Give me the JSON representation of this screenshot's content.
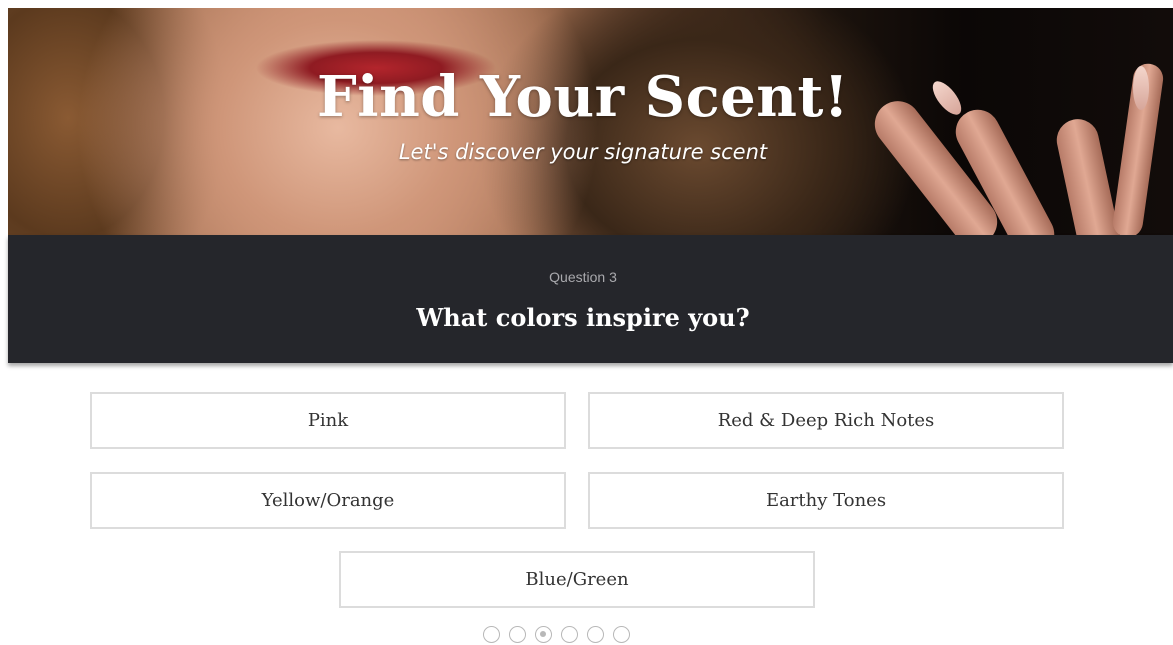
{
  "hero": {
    "title": "Find Your Scent!",
    "subtitle": "Let's discover your signature scent"
  },
  "question": {
    "number_label": "Question 3",
    "text": "What colors inspire you?"
  },
  "answers": [
    {
      "label": "Pink"
    },
    {
      "label": "Red & Deep Rich Notes"
    },
    {
      "label": "Yellow/Orange"
    },
    {
      "label": "Earthy Tones"
    },
    {
      "label": "Blue/Green"
    }
  ],
  "pagination": {
    "total_steps": 6,
    "current_step": 3
  },
  "colors": {
    "question_band": "#25262b",
    "answer_border": "#dcdcdc",
    "text": "#333333"
  }
}
